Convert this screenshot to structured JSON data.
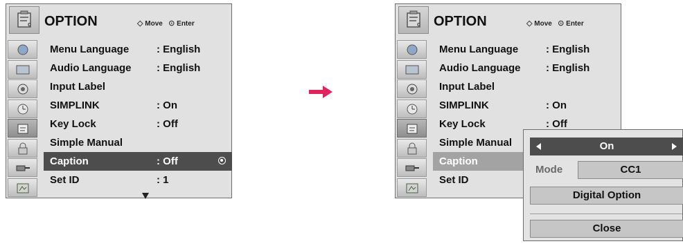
{
  "screen": {
    "title": "OPTION",
    "hint_move": "Move",
    "hint_enter": "Enter",
    "menu": [
      {
        "label": "Menu Language",
        "value": ": English"
      },
      {
        "label": "Audio Language",
        "value": ": English"
      },
      {
        "label": "Input Label",
        "value": ""
      },
      {
        "label": "SIMPLINK",
        "value": ": On"
      },
      {
        "label": "Key Lock",
        "value": ": Off"
      },
      {
        "label": "Simple Manual",
        "value": ""
      },
      {
        "label": "Caption",
        "value": ": Off"
      },
      {
        "label": "Set ID",
        "value": ": 1"
      }
    ],
    "side_icons": [
      "picture-icon",
      "display-icon",
      "audio-icon",
      "clock-icon",
      "option-icon",
      "lock-icon",
      "input-icon",
      "usb-icon"
    ]
  },
  "popup": {
    "caption_value": "On",
    "mode_label": "Mode",
    "mode_value": "CC1",
    "digital_option_label": "Digital Option",
    "close_label": "Close"
  },
  "colors": {
    "selected_row": "#4d4d4d",
    "panel_bg": "#e1e1e1",
    "arrow": "#e0245e"
  }
}
